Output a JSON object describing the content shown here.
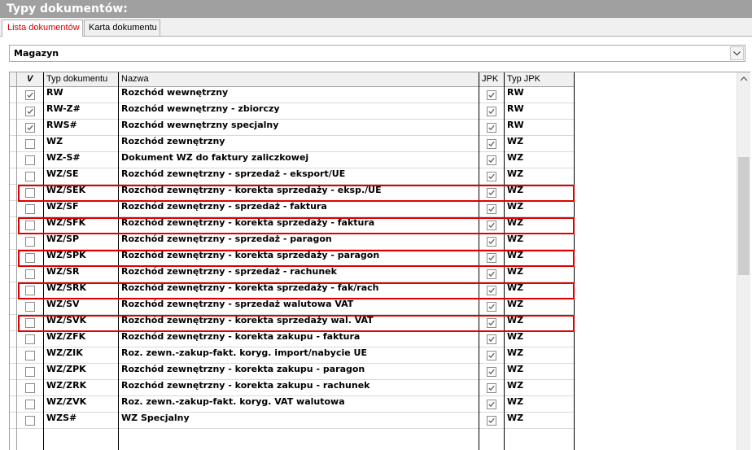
{
  "title": "Typy dokumentów:",
  "tabs": [
    {
      "label": "Lista dokumentów",
      "active": true
    },
    {
      "label": "Karta dokumentu",
      "active": false
    }
  ],
  "warehouse_select": {
    "value": "Magazyn"
  },
  "columns": {
    "check": "V",
    "type": "Typ dokumentu",
    "name": "Nazwa",
    "jpk": "JPK",
    "jpk_type": "Typ JPK"
  },
  "colors": {
    "highlight": "#e00000",
    "title_bar": "#a0a0a0",
    "active_tab_text": "#d00000"
  },
  "rows": [
    {
      "checked": true,
      "type": "RW",
      "name": "Rozchód wewnętrzny",
      "jpk": true,
      "jpk_type": "RW",
      "highlighted": false
    },
    {
      "checked": true,
      "type": "RW-Z#",
      "name": "Rozchód wewnętrzny - zbiorczy",
      "jpk": true,
      "jpk_type": "RW",
      "highlighted": false
    },
    {
      "checked": true,
      "type": "RWS#",
      "name": "Rozchód wewnętrzny specjalny",
      "jpk": true,
      "jpk_type": "RW",
      "highlighted": false
    },
    {
      "checked": false,
      "type": "WZ",
      "name": "Rozchód zewnętrzny",
      "jpk": true,
      "jpk_type": "WZ",
      "highlighted": false
    },
    {
      "checked": false,
      "type": "WZ-S#",
      "name": "Dokument WZ do faktury zaliczkowej",
      "jpk": true,
      "jpk_type": "WZ",
      "highlighted": false
    },
    {
      "checked": false,
      "type": "WZ/SE",
      "name": "Rozchód zewnętrzny - sprzedaż - eksport/UE",
      "jpk": true,
      "jpk_type": "WZ",
      "highlighted": false
    },
    {
      "checked": false,
      "type": "WZ/SEK",
      "name": "Rozchód zewnętrzny - korekta sprzedaży - eksp./UE",
      "jpk": true,
      "jpk_type": "WZ",
      "highlighted": true
    },
    {
      "checked": false,
      "type": "WZ/SF",
      "name": "Rozchód zewnętrzny - sprzedaż - faktura",
      "jpk": true,
      "jpk_type": "WZ",
      "highlighted": false
    },
    {
      "checked": false,
      "type": "WZ/SFK",
      "name": "Rozchód zewnętrzny - korekta sprzedaży - faktura",
      "jpk": true,
      "jpk_type": "WZ",
      "highlighted": true
    },
    {
      "checked": false,
      "type": "WZ/SP",
      "name": "Rozchód zewnętrzny - sprzedaż - paragon",
      "jpk": true,
      "jpk_type": "WZ",
      "highlighted": false
    },
    {
      "checked": false,
      "type": "WZ/SPK",
      "name": "Rozchód zewnętrzny - korekta sprzedaży - paragon",
      "jpk": true,
      "jpk_type": "WZ",
      "highlighted": true
    },
    {
      "checked": false,
      "type": "WZ/SR",
      "name": "Rozchód zewnętrzny - sprzedaż - rachunek",
      "jpk": true,
      "jpk_type": "WZ",
      "highlighted": false
    },
    {
      "checked": false,
      "type": "WZ/SRK",
      "name": "Rozchód zewnętrzny - korekta sprzedaży - fak/rach",
      "jpk": true,
      "jpk_type": "WZ",
      "highlighted": true
    },
    {
      "checked": false,
      "type": "WZ/SV",
      "name": "Rozchód zewnętrzny - sprzedaż walutowa VAT",
      "jpk": true,
      "jpk_type": "WZ",
      "highlighted": false
    },
    {
      "checked": false,
      "type": "WZ/SVK",
      "name": "Rozchód zewnętrzny - korekta sprzedaży wal. VAT",
      "jpk": true,
      "jpk_type": "WZ",
      "highlighted": true
    },
    {
      "checked": false,
      "type": "WZ/ZFK",
      "name": "Rozchód zewnętrzny - korekta zakupu - faktura",
      "jpk": true,
      "jpk_type": "WZ",
      "highlighted": false
    },
    {
      "checked": false,
      "type": "WZ/ZIK",
      "name": "Roz. zewn.-zakup-fakt. koryg. import/nabycie UE",
      "jpk": true,
      "jpk_type": "WZ",
      "highlighted": false
    },
    {
      "checked": false,
      "type": "WZ/ZPK",
      "name": "Rozchód zewnętrzny - korekta zakupu - paragon",
      "jpk": true,
      "jpk_type": "WZ",
      "highlighted": false
    },
    {
      "checked": false,
      "type": "WZ/ZRK",
      "name": "Rozchód zewnętrzny - korekta zakupu - rachunek",
      "jpk": true,
      "jpk_type": "WZ",
      "highlighted": false
    },
    {
      "checked": false,
      "type": "WZ/ZVK",
      "name": "Roz. zewn.-zakup-fakt. koryg. VAT walutowa",
      "jpk": true,
      "jpk_type": "WZ",
      "highlighted": false
    },
    {
      "checked": false,
      "type": "WZS#",
      "name": "WZ Specjalny",
      "jpk": true,
      "jpk_type": "WZ",
      "highlighted": false
    }
  ]
}
